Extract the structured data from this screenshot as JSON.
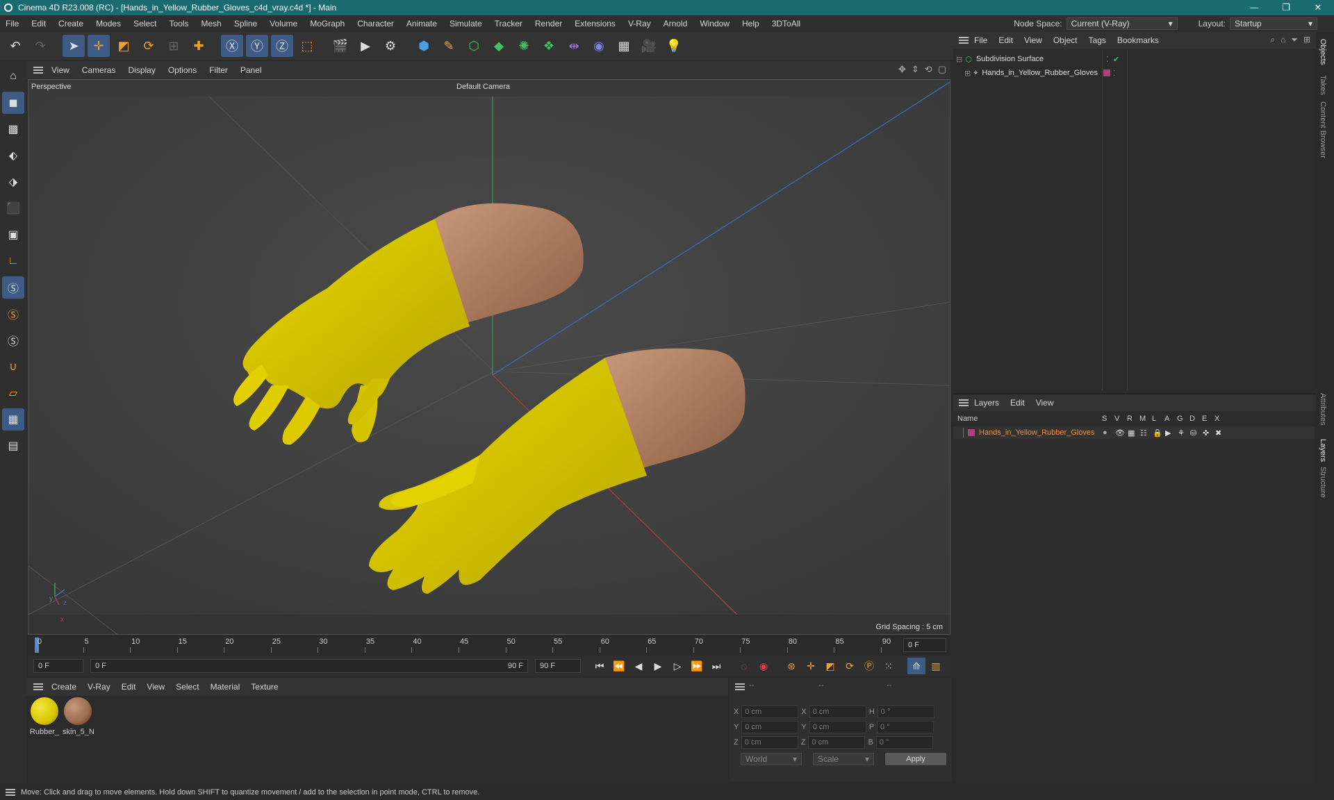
{
  "window": {
    "title": "Cinema 4D R23.008 (RC) - [Hands_in_Yellow_Rubber_Gloves_c4d_vray.c4d *] - Main",
    "minimize": "—",
    "maximize": "❐",
    "close": "✕"
  },
  "menu": [
    "File",
    "Edit",
    "Create",
    "Modes",
    "Select",
    "Tools",
    "Mesh",
    "Spline",
    "Volume",
    "MoGraph",
    "Character",
    "Animate",
    "Simulate",
    "Tracker",
    "Render",
    "Extensions",
    "V-Ray",
    "Arnold",
    "Window",
    "Help",
    "3DToAll"
  ],
  "node_space": {
    "label": "Node Space:",
    "value": "Current (V-Ray)"
  },
  "layout": {
    "label": "Layout:",
    "value": "Startup"
  },
  "viewport": {
    "menu": [
      "View",
      "Cameras",
      "Display",
      "Options",
      "Filter",
      "Panel"
    ],
    "label": "Perspective",
    "camera": "Default Camera",
    "grid_spacing": "Grid Spacing : 5 cm",
    "axis_y": "y",
    "axis_z": "z",
    "axis_x": "x"
  },
  "timeline": {
    "ticks": [
      "0",
      "5",
      "10",
      "15",
      "20",
      "25",
      "30",
      "35",
      "40",
      "45",
      "50",
      "55",
      "60",
      "65",
      "70",
      "75",
      "80",
      "85",
      "90"
    ],
    "current_frame": "0 F"
  },
  "transport": {
    "start": "0 F",
    "range_start": "0 F",
    "range_end": "90 F",
    "end": "90 F"
  },
  "materials": {
    "menu": [
      "Create",
      "V-Ray",
      "Edit",
      "View",
      "Select",
      "Material",
      "Texture"
    ],
    "items": [
      {
        "name": "Rubber_",
        "color": "#d8c600"
      },
      {
        "name": "skin_5_N",
        "color": "#9a6a4c"
      }
    ]
  },
  "coords": {
    "headers": [
      "--",
      "--",
      "--"
    ],
    "rows": [
      {
        "a": "X",
        "v1": "0 cm",
        "b": "X",
        "v2": "0 cm",
        "c": "H",
        "v3": "0 °"
      },
      {
        "a": "Y",
        "v1": "0 cm",
        "b": "Y",
        "v2": "0 cm",
        "c": "P",
        "v3": "0 °"
      },
      {
        "a": "Z",
        "v1": "0 cm",
        "b": "Z",
        "v2": "0 cm",
        "c": "B",
        "v3": "0 °"
      }
    ],
    "world": "World",
    "scale": "Scale",
    "apply": "Apply"
  },
  "objects": {
    "menu": [
      "File",
      "Edit",
      "View",
      "Object",
      "Tags",
      "Bookmarks"
    ],
    "items": [
      {
        "name": "Subdivision Surface"
      },
      {
        "name": "Hands_in_Yellow_Rubber_Gloves"
      }
    ]
  },
  "layers": {
    "menu": [
      "Layers",
      "Edit",
      "View"
    ],
    "columns_name": "Name",
    "columns": [
      "S",
      "V",
      "R",
      "M",
      "L",
      "A",
      "G",
      "D",
      "E",
      "X"
    ],
    "items": [
      {
        "name": "Hands_in_Yellow_Rubber_Gloves",
        "color": "#a8427a"
      }
    ]
  },
  "right_tabs": [
    "Objects",
    "Takes",
    "Content Browser",
    "Attributes",
    "Layers",
    "Structure"
  ],
  "status": "Move: Click and drag to move elements. Hold down SHIFT to quantize movement / add to the selection in point mode, CTRL to remove."
}
